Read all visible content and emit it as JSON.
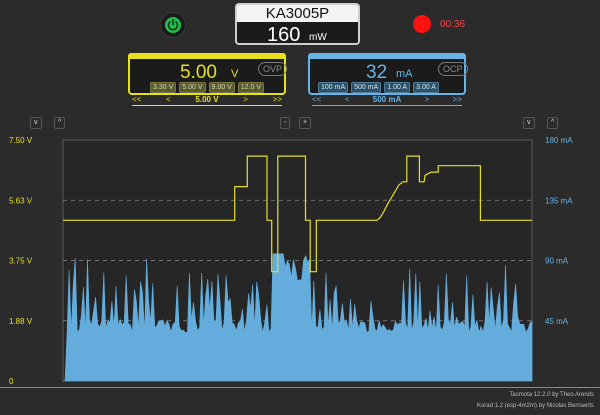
{
  "header": {
    "device_name": "KA3005P",
    "power_value": "160",
    "power_unit": "mW",
    "record_time": "00:36"
  },
  "voltage": {
    "value": "5.00",
    "unit": "V",
    "protection_label": "OVP",
    "presets": [
      "3.30 V",
      "5.00 V",
      "9.00 V",
      "12.0 V"
    ],
    "stepper": {
      "fast_down": "<<",
      "down": "<",
      "value": "5.00 V",
      "up": ">",
      "fast_up": ">>"
    }
  },
  "current": {
    "value": "32",
    "unit": "mA",
    "protection_label": "OCP",
    "presets": [
      "100 mA",
      "500 mA",
      "1.00 A",
      "3.00 A"
    ],
    "stepper": {
      "fast_down": "<<",
      "down": "<",
      "value": "500 mA",
      "up": ">",
      "fast_up": ">>"
    }
  },
  "controls": {
    "left_down": "v",
    "left_up": "^",
    "zoom_out": "-",
    "zoom_in": "+",
    "right_down": "v",
    "right_up": "^"
  },
  "colors": {
    "voltage": "#e6e020",
    "current": "#68b4e6",
    "power_on": "#22c04a",
    "record": "#ff1111"
  },
  "icons": {
    "power": "power-icon",
    "record": "record-dot-icon"
  },
  "chart_data": {
    "type": "line",
    "y_left": {
      "ticks": [
        "0",
        "1.88 V",
        "3.75 V",
        "5.63 V",
        "7.50 V"
      ],
      "range": [
        0,
        7.5
      ]
    },
    "y_right": {
      "ticks": [
        "45 mA",
        "90 mA",
        "135 mA",
        "180 mA"
      ],
      "range": [
        0,
        180
      ]
    },
    "grid": true,
    "series": [
      {
        "kind": "voltage-line",
        "points": [
          [
            0,
            5.0
          ],
          [
            0.366,
            5.0
          ],
          [
            0.366,
            6.05
          ],
          [
            0.393,
            6.05
          ],
          [
            0.393,
            7.0
          ],
          [
            0.435,
            7.0
          ],
          [
            0.435,
            5.0
          ],
          [
            0.445,
            5.0
          ],
          [
            0.445,
            3.4
          ],
          [
            0.458,
            3.4
          ],
          [
            0.458,
            7.0
          ],
          [
            0.517,
            7.0
          ],
          [
            0.517,
            5.0
          ],
          [
            0.527,
            5.0
          ],
          [
            0.527,
            3.4
          ],
          [
            0.54,
            3.4
          ],
          [
            0.54,
            5.0
          ],
          [
            0.67,
            5.0
          ],
          [
            0.677,
            5.1
          ],
          [
            0.685,
            5.3
          ],
          [
            0.692,
            5.5
          ],
          [
            0.7,
            5.7
          ],
          [
            0.708,
            5.9
          ],
          [
            0.716,
            6.1
          ],
          [
            0.725,
            6.2
          ],
          [
            0.733,
            6.2
          ],
          [
            0.733,
            7.0
          ],
          [
            0.76,
            7.0
          ],
          [
            0.76,
            6.2
          ],
          [
            0.77,
            6.2
          ],
          [
            0.772,
            6.4
          ],
          [
            0.785,
            6.5
          ],
          [
            0.8,
            6.5
          ],
          [
            0.8,
            6.7
          ],
          [
            0.89,
            6.7
          ],
          [
            0.89,
            5.0
          ],
          [
            1.0,
            5.0
          ]
        ]
      },
      {
        "kind": "current-area",
        "base_level": 40,
        "seed": 7
      }
    ]
  },
  "footer": {
    "line1": "Tasmota 12.2.0 by Theo Arends",
    "line2": "Korad 1.2 (esp-4m2m) by Nicolas Bernaerts"
  }
}
